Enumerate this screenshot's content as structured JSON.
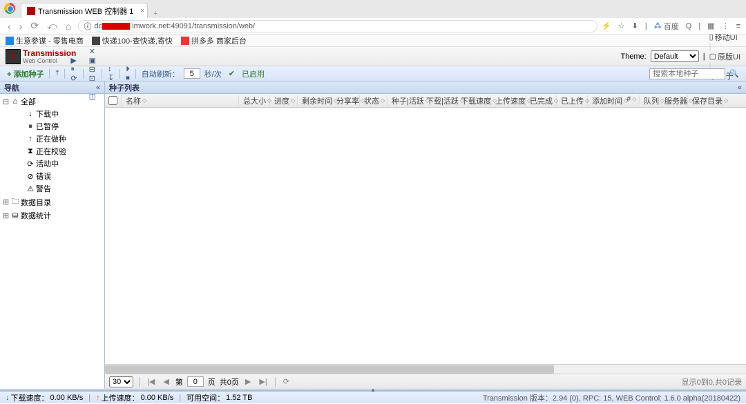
{
  "window_controls": {
    "min": "—",
    "max": "☐",
    "close": "✕"
  },
  "tab": {
    "title": "Transmission WEB 控制器 1",
    "close": "×",
    "new": "+"
  },
  "addr": {
    "back": "‹",
    "fwd": "›",
    "reload": "⟳",
    "undo": "⤺",
    "home": "⌂",
    "lock": "ⓘ",
    "url_pre": "dc",
    "url_post": ".imwork.net:49091/transmission/web/",
    "icons": [
      "⚡",
      "☆",
      "⬇"
    ],
    "sep": "|",
    "baidu_ico": "⁂",
    "baidu": "百度",
    "search": "Q",
    "ext": "▦",
    "more": "⋮",
    "menu": "≡"
  },
  "bookmarks": [
    {
      "ico": "#1e88e5",
      "label": "生意参谋 - 零售电商"
    },
    {
      "ico": "#424242",
      "label": "快递100-查快递,寄快"
    },
    {
      "ico": "#e53935",
      "label": "拼多多 商家后台"
    }
  ],
  "header": {
    "title": "Transmission",
    "subtitle": "Web Control",
    "theme_label": "Theme:",
    "theme_value": "Default",
    "links": [
      {
        "ico": "▯",
        "label": "移动UI"
      },
      {
        "ico": "▢",
        "label": "原版UI"
      },
      {
        "ico": "ⓘ",
        "label": "关于"
      }
    ]
  },
  "toolbar": {
    "add": "+ 添加种子",
    "start": "⤒",
    "grp1": [
      "▶",
      "⏸",
      "⟳",
      "✿"
    ],
    "sep": "|",
    "grp2": [
      "✕",
      "▣",
      "⊟",
      "⊡",
      "⎘",
      "◫"
    ],
    "grp3": [
      "↕",
      "↧"
    ],
    "grp4": [
      "⏵",
      "⏹"
    ],
    "auto_label": "自动刷新：",
    "auto_val": "5",
    "auto_unit": "秒/次",
    "enabled_ico": "✔",
    "enabled": "已启用",
    "search_placeholder": "搜索本地种子",
    "search_ico": "🔍"
  },
  "nav": {
    "title": "导航",
    "collapse": "«",
    "items": [
      {
        "t": "⊟",
        "i": "⌂",
        "l": "全部",
        "ind": 0
      },
      {
        "t": "",
        "i": "↓",
        "l": "下载中",
        "ind": 1
      },
      {
        "t": "",
        "i": "⏸",
        "l": "已暂停",
        "ind": 1
      },
      {
        "t": "",
        "i": "↑",
        "l": "正在做种",
        "ind": 1
      },
      {
        "t": "",
        "i": "⧗",
        "l": "正在校验",
        "ind": 1
      },
      {
        "t": "",
        "i": "⟳",
        "l": "活动中",
        "ind": 1
      },
      {
        "t": "",
        "i": "⊘",
        "l": "错误",
        "ind": 1
      },
      {
        "t": "",
        "i": "⚠",
        "l": "警告",
        "ind": 1
      },
      {
        "t": "⊞",
        "i": "🗀",
        "l": "数据目录",
        "ind": 0
      },
      {
        "t": "⊞",
        "i": "⛁",
        "l": "数据统计",
        "ind": 0
      }
    ]
  },
  "list": {
    "title": "种子列表",
    "collapse": "«",
    "cols": [
      "名称",
      "总大小",
      "进度",
      "剩余时间",
      "分享率",
      "状态",
      "种子|活跃",
      "下载|活跃",
      "下载速度",
      "上传速度",
      "已完成",
      "已上传",
      "添加时间",
      "#",
      "队列",
      "服务器",
      "保存目录"
    ]
  },
  "pager": {
    "size": "30",
    "sizes": [
      "30"
    ],
    "first": "|◀",
    "prev": "◀",
    "page_pre": "第",
    "page_val": "0",
    "page_post": "页",
    "total": "共0页",
    "next": "▶",
    "last": "▶|",
    "refresh": "⟳",
    "info": "显示0到0,共0记录"
  },
  "status": {
    "dn": "↓",
    "dn_label": "下载速度：",
    "dn_val": "0.00 KB/s",
    "up": "↑",
    "up_label": "上传速度：",
    "up_val": "0.00 KB/s",
    "space_label": "可用空间：",
    "space_val": "1.52 TB",
    "version": "Transmission 版本：2.94 (0), RPC: 15, WEB Control: 1.6.0 alpha(20180422)"
  },
  "splitter": "▲"
}
